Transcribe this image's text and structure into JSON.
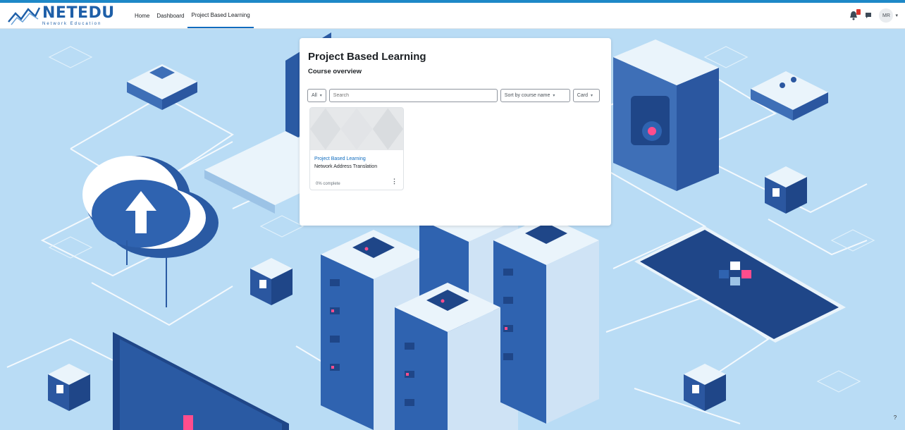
{
  "brand": {
    "name": "NETEDU",
    "tagline": "Network Education"
  },
  "nav": {
    "home": "Home",
    "dashboard": "Dashboard",
    "current": "Project Based Learning"
  },
  "user": {
    "initials": "MR"
  },
  "page": {
    "title": "Project Based Learning",
    "section": "Course overview"
  },
  "filters": {
    "grouping": "All",
    "search_placeholder": "Search",
    "sort": "Sort by course name",
    "view": "Card"
  },
  "courses": [
    {
      "category": "Project Based Learning",
      "name": "Network Address Translation",
      "progress_text": "0% complete",
      "progress_pct": 0
    }
  ],
  "help": {
    "label": "?"
  },
  "colors": {
    "accent": "#0f6cbf",
    "navbar_top": "#1e88c7",
    "background": "#b9dcf5",
    "brand": "#1e5fa8"
  }
}
